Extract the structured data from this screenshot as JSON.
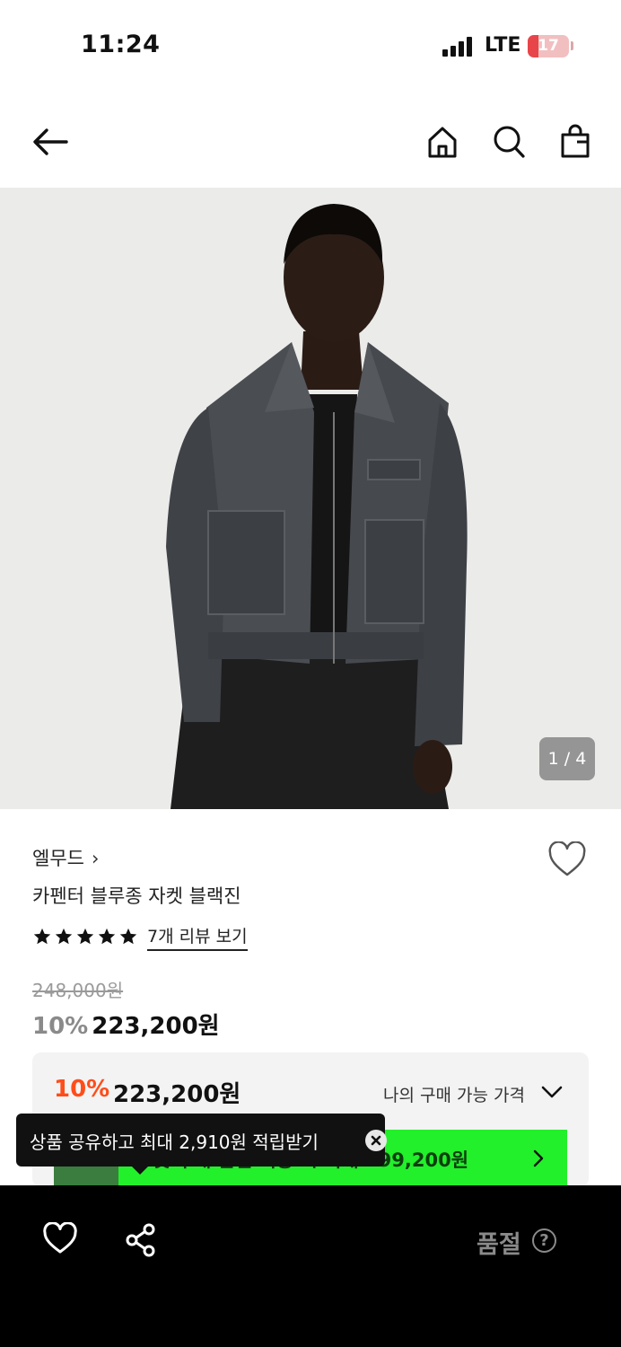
{
  "status_bar": {
    "time": "11:24",
    "network": "LTE",
    "battery": "17"
  },
  "nav": {
    "back_icon": "arrow-left-icon",
    "home_icon": "home-icon",
    "search_icon": "search-icon",
    "bag_icon": "shopping-bag-icon"
  },
  "gallery": {
    "counter": "1 / 4"
  },
  "product": {
    "brand": "엘무드",
    "brand_chevron": "›",
    "name": "카펜터 블루종 자켓 블랙진",
    "rating_stars": 5,
    "review_link": "7개 리뷰 보기",
    "original_price": "248,000원",
    "discount_rate": "10%",
    "sale_price": "223,200원"
  },
  "my_price": {
    "rate": "10%",
    "price": "223,200원",
    "label": "나의 구매 가능 가격",
    "banner_text": "첫 구매 할인 적용 시 최대 199,200원",
    "accent_color": "#ff4d1a",
    "banner_color": "#22f02a"
  },
  "tooltip": {
    "text": "상품 공유하고 최대 2,910원 적립받기"
  },
  "bottom_bar": {
    "status": "품절",
    "help": "?"
  }
}
